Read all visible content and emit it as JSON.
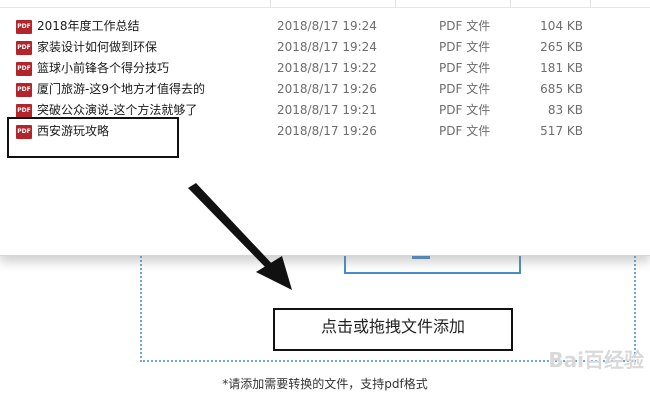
{
  "files": [
    {
      "name": "2018年度工作总结",
      "date": "2018/8/17 19:24",
      "type": "PDF 文件",
      "size": "104 KB",
      "icon": "pdf-icon"
    },
    {
      "name": "家装设计如何做到环保",
      "date": "2018/8/17 19:24",
      "type": "PDF 文件",
      "size": "265 KB",
      "icon": "pdf-icon"
    },
    {
      "name": "篮球小前锋各个得分技巧",
      "date": "2018/8/17 19:22",
      "type": "PDF 文件",
      "size": "181 KB",
      "icon": "pdf-icon"
    },
    {
      "name": "厦门旅游-这9个地方才值得去的",
      "date": "2018/8/17 19:26",
      "type": "PDF 文件",
      "size": "685 KB",
      "icon": "pdf-icon"
    },
    {
      "name": "突破公众演说-这个方法就够了",
      "date": "2018/8/17 19:21",
      "type": "PDF 文件",
      "size": "83 KB",
      "icon": "pdf-icon"
    },
    {
      "name": "西安游玩攻略",
      "date": "2018/8/17 19:26",
      "type": "PDF 文件",
      "size": "517 KB",
      "icon": "pdf-icon"
    }
  ],
  "icon_text": "PDF",
  "dropzone": {
    "label": "点击或拖拽文件添加",
    "hint": "*请添加需要转换的文件，支持pdf格式"
  },
  "watermark": "Bai百经验",
  "colors": {
    "pdf_icon": "#b3252a",
    "accent": "#4a8ccd",
    "annotation": "#111111"
  }
}
